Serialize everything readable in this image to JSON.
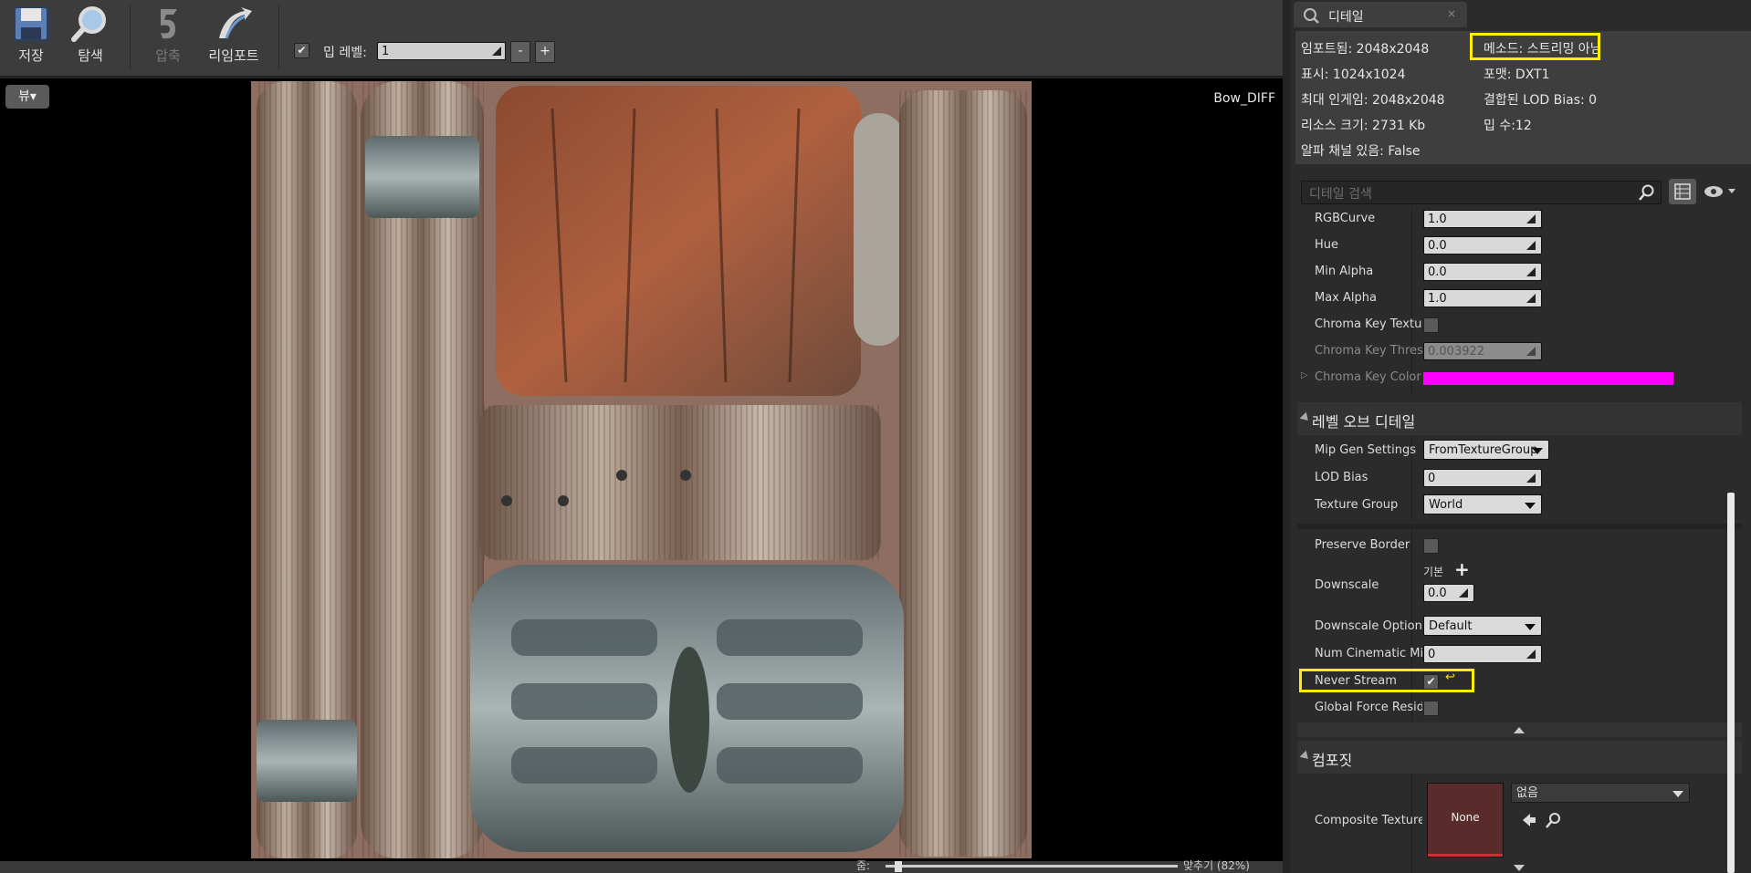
{
  "toolbar": {
    "save_label": "저장",
    "browse_label": "탐색",
    "compress_label": "압축",
    "reimport_label": "리임포트",
    "mip_level_label": "밉 레벨:",
    "mip_level_value": "1",
    "minus_label": "-",
    "plus_label": "+"
  },
  "viewport": {
    "view_button_label": "뷰▾",
    "texture_name": "Bow_DIFF"
  },
  "bottombar": {
    "zoom_label": "줌:",
    "fit_label": "맞추기 (82%)"
  },
  "details_tab": {
    "title": "디테일"
  },
  "info": {
    "imported": "임포트됨: 2048x2048",
    "displayed": "표시: 1024x1024",
    "max_ingame": "최대 인게임: 2048x2048",
    "resource_size": "리소스 크기: 2731 Kb",
    "has_alpha": "알파 채널 있음: False",
    "method": "메소드: 스트리밍 아님",
    "format": "포맷: DXT1",
    "combined_lod_bias": "결합된 LOD Bias: 0",
    "num_mips": "밉 수:12"
  },
  "search": {
    "placeholder": "디테일 검색"
  },
  "props": {
    "rgbcurve_label": "RGBCurve",
    "rgbcurve_value": "1.0",
    "hue_label": "Hue",
    "hue_value": "0.0",
    "min_alpha_label": "Min Alpha",
    "min_alpha_value": "0.0",
    "max_alpha_label": "Max Alpha",
    "max_alpha_value": "1.0",
    "chroma_key_texture_label": "Chroma Key Texture",
    "chroma_key_threshold_label": "Chroma Key Threshold",
    "chroma_key_threshold_value": "0.003922",
    "chroma_key_color_label": "Chroma Key Color",
    "chroma_key_color": "#ff00ff"
  },
  "lod_section": {
    "title": "레벨 오브 디테일",
    "mip_gen_label": "Mip Gen Settings",
    "mip_gen_value": "FromTextureGroup",
    "lod_bias_label": "LOD Bias",
    "lod_bias_value": "0",
    "texture_group_label": "Texture Group",
    "texture_group_value": "World",
    "preserve_border_label": "Preserve Border",
    "downscale_label": "Downscale",
    "downscale_default": "기본",
    "downscale_value": "0.0",
    "downscale_options_label": "Downscale Options",
    "downscale_options_value": "Default",
    "num_cinematic_label": "Num Cinematic Mip Levels",
    "num_cinematic_value": "0",
    "never_stream_label": "Never Stream",
    "global_force_label": "Global Force Resident Mip Levels"
  },
  "composite_section": {
    "title": "컴포짓",
    "composite_texture_label": "Composite Texture",
    "thumbnail_label": "None",
    "asset_value": "없음"
  },
  "colors": {
    "highlight": "#ffee00",
    "accent_red": "#c83232"
  }
}
